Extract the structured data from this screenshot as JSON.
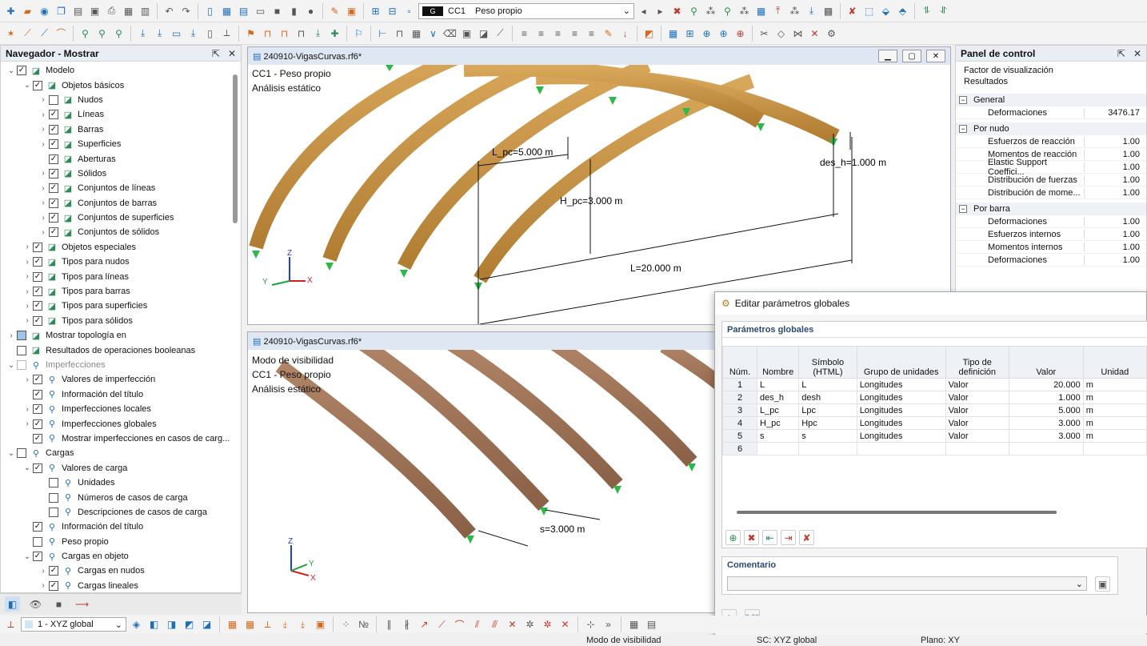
{
  "toolbar1": {
    "lc_badge": "G",
    "lc_code": "CC1",
    "lc_name": "Peso propio"
  },
  "navigator": {
    "title": "Navegador - Mostrar",
    "items": [
      {
        "label": "Modelo",
        "level": 0,
        "chev": "v",
        "cb": "checked",
        "icon": "a"
      },
      {
        "label": "Objetos básicos",
        "level": 1,
        "chev": "v",
        "cb": "checked",
        "icon": "a"
      },
      {
        "label": "Nudos",
        "level": 2,
        "chev": ">",
        "cb": "unchecked",
        "icon": "a"
      },
      {
        "label": "Líneas",
        "level": 2,
        "chev": ">",
        "cb": "checked",
        "icon": "a"
      },
      {
        "label": "Barras",
        "level": 2,
        "chev": ">",
        "cb": "checked",
        "icon": "a"
      },
      {
        "label": "Superficies",
        "level": 2,
        "chev": ">",
        "cb": "checked",
        "icon": "a"
      },
      {
        "label": "Aberturas",
        "level": 2,
        "chev": "",
        "cb": "checked",
        "icon": "a"
      },
      {
        "label": "Sólidos",
        "level": 2,
        "chev": ">",
        "cb": "checked",
        "icon": "a"
      },
      {
        "label": "Conjuntos de líneas",
        "level": 2,
        "chev": ">",
        "cb": "checked",
        "icon": "a"
      },
      {
        "label": "Conjuntos de barras",
        "level": 2,
        "chev": ">",
        "cb": "checked",
        "icon": "a"
      },
      {
        "label": "Conjuntos de superficies",
        "level": 2,
        "chev": ">",
        "cb": "checked",
        "icon": "a"
      },
      {
        "label": "Conjuntos de sólidos",
        "level": 2,
        "chev": ">",
        "cb": "checked",
        "icon": "a"
      },
      {
        "label": "Objetos especiales",
        "level": 1,
        "chev": ">",
        "cb": "checked",
        "icon": "a"
      },
      {
        "label": "Tipos para nudos",
        "level": 1,
        "chev": ">",
        "cb": "checked",
        "icon": "a"
      },
      {
        "label": "Tipos para líneas",
        "level": 1,
        "chev": ">",
        "cb": "checked",
        "icon": "a"
      },
      {
        "label": "Tipos para barras",
        "level": 1,
        "chev": ">",
        "cb": "checked",
        "icon": "a"
      },
      {
        "label": "Tipos para superficies",
        "level": 1,
        "chev": ">",
        "cb": "checked",
        "icon": "a"
      },
      {
        "label": "Tipos para sólidos",
        "level": 1,
        "chev": ">",
        "cb": "checked",
        "icon": "a"
      },
      {
        "label": "Mostrar topología en",
        "level": 0,
        "chev": ">",
        "cb": "partial",
        "icon": "a"
      },
      {
        "label": "Resultados de operaciones booleanas",
        "level": 0,
        "chev": "",
        "cb": "unchecked",
        "icon": "a"
      },
      {
        "label": "Imperfecciones",
        "level": 0,
        "chev": "v",
        "cb": "dim",
        "icon": "b",
        "dim": true
      },
      {
        "label": "Valores de imperfección",
        "level": 1,
        "chev": ">",
        "cb": "checked",
        "icon": "b"
      },
      {
        "label": "Información del título",
        "level": 1,
        "chev": "",
        "cb": "checked",
        "icon": "b"
      },
      {
        "label": "Imperfecciones locales",
        "level": 1,
        "chev": ">",
        "cb": "checked",
        "icon": "b"
      },
      {
        "label": "Imperfecciones globales",
        "level": 1,
        "chev": ">",
        "cb": "checked",
        "icon": "b"
      },
      {
        "label": "Mostrar imperfecciones en casos de carg...",
        "level": 1,
        "chev": "",
        "cb": "checked",
        "icon": "b"
      },
      {
        "label": "Cargas",
        "level": 0,
        "chev": "v",
        "cb": "unchecked",
        "icon": "b"
      },
      {
        "label": "Valores de carga",
        "level": 1,
        "chev": "v",
        "cb": "checked",
        "icon": "b"
      },
      {
        "label": "Unidades",
        "level": 2,
        "chev": "",
        "cb": "unchecked",
        "icon": "b"
      },
      {
        "label": "Números de casos de carga",
        "level": 2,
        "chev": "",
        "cb": "unchecked",
        "icon": "b"
      },
      {
        "label": "Descripciones de casos de carga",
        "level": 2,
        "chev": "",
        "cb": "unchecked",
        "icon": "b"
      },
      {
        "label": "Información del título",
        "level": 1,
        "chev": "",
        "cb": "checked",
        "icon": "b"
      },
      {
        "label": "Peso propio",
        "level": 1,
        "chev": "",
        "cb": "unchecked",
        "icon": "b"
      },
      {
        "label": "Cargas en objeto",
        "level": 1,
        "chev": "v",
        "cb": "checked",
        "icon": "b"
      },
      {
        "label": "Cargas en nudos",
        "level": 2,
        "chev": ">",
        "cb": "checked",
        "icon": "b"
      },
      {
        "label": "Cargas lineales",
        "level": 2,
        "chev": ">",
        "cb": "checked",
        "icon": "b"
      }
    ]
  },
  "viewport1": {
    "title": "240910-VigasCurvas.rf6*",
    "info": [
      "CC1 - Peso propio",
      "Análisis estático"
    ],
    "dims": {
      "lpc": "L_pc=5.000 m",
      "hpc": "H_pc=3.000 m",
      "desh": "des_h=1.000 m",
      "l": "L=20.000 m"
    },
    "axes": {
      "x": "X",
      "y": "Y",
      "z": "Z"
    }
  },
  "viewport2": {
    "title": "240910-VigasCurvas.rf6*",
    "info": [
      "Modo de visibilidad",
      "CC1 - Peso propio",
      "Análisis estático"
    ],
    "dims": {
      "s": "s=3.000 m"
    },
    "axes": {
      "x": "X",
      "y": "Y",
      "z": "Z"
    }
  },
  "control_panel": {
    "title": "Panel de control",
    "header_lines": [
      "Factor de visualización",
      "Resultados"
    ],
    "sections": [
      {
        "name": "General",
        "rows": [
          {
            "label": "Deformaciones",
            "value": "3476.17"
          }
        ]
      },
      {
        "name": "Por nudo",
        "rows": [
          {
            "label": "Esfuerzos de reacción",
            "value": "1.00"
          },
          {
            "label": "Momentos de reacción",
            "value": "1.00"
          },
          {
            "label": "Elastic Support Coeffici...",
            "value": "1.00"
          },
          {
            "label": "Distribución de fuerzas",
            "value": "1.00"
          },
          {
            "label": "Distribución de mome...",
            "value": "1.00"
          }
        ]
      },
      {
        "name": "Por barra",
        "rows": [
          {
            "label": "Deformaciones",
            "value": "1.00"
          },
          {
            "label": "Esfuerzos internos",
            "value": "1.00"
          },
          {
            "label": "Momentos internos",
            "value": "1.00"
          },
          {
            "label": "Deformaciones",
            "value": "1.00"
          }
        ]
      }
    ]
  },
  "dialog": {
    "title": "Editar parámetros globales",
    "section": "Parámetros globales",
    "columns": [
      "Núm.",
      "Nombre",
      "Símbolo (HTML)",
      "Grupo de unidades",
      "Tipo de definición",
      "Valor",
      "Unidad"
    ],
    "rows": [
      [
        "1",
        "L",
        "L",
        "Longitudes",
        "Valor",
        "20.000",
        "m"
      ],
      [
        "2",
        "des_h",
        "desh",
        "Longitudes",
        "Valor",
        "1.000",
        "m"
      ],
      [
        "3",
        "L_pc",
        "Lpc",
        "Longitudes",
        "Valor",
        "5.000",
        "m"
      ],
      [
        "4",
        "H_pc",
        "Hpc",
        "Longitudes",
        "Valor",
        "3.000",
        "m"
      ],
      [
        "5",
        "s",
        "s",
        "Longitudes",
        "Valor",
        "3.000",
        "m"
      ],
      [
        "6",
        "",
        "",
        "",
        "",
        "",
        ""
      ]
    ],
    "comment_label": "Comentario",
    "comment_value": ""
  },
  "bottom_toolbar": {
    "view_select": "1 - XYZ global"
  },
  "status": {
    "mode": "Modo de visibilidad",
    "cs": "SC: XYZ global",
    "plane": "Plano: XY"
  }
}
